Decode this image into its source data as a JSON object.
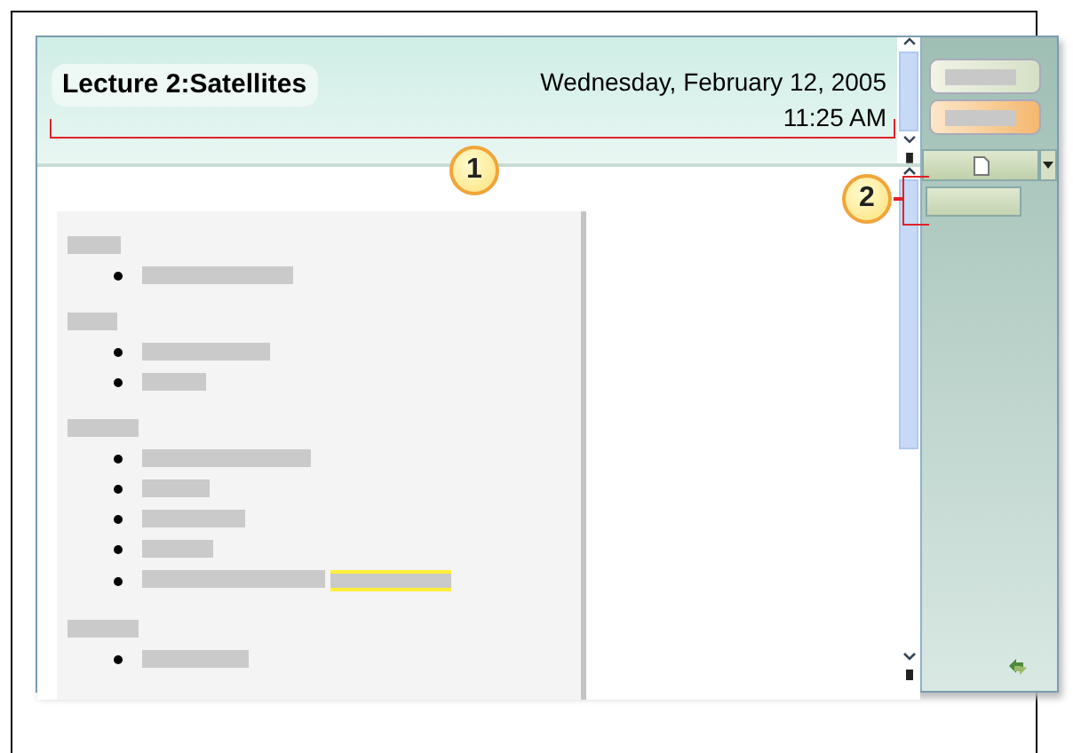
{
  "page": {
    "title": "Lecture 2:Satellites",
    "date": "Wednesday, February 12, 2005",
    "time": "11:25 AM"
  },
  "outline": [
    {
      "items": [
        {
          "highlighted": false
        }
      ]
    },
    {
      "items": [
        {
          "highlighted": false
        },
        {
          "highlighted": false
        }
      ]
    },
    {
      "items": [
        {
          "highlighted": false
        },
        {
          "highlighted": false
        },
        {
          "highlighted": false
        },
        {
          "highlighted": false
        },
        {
          "highlighted": true
        }
      ]
    },
    {
      "items": [
        {
          "highlighted": false
        }
      ]
    }
  ],
  "callouts": [
    {
      "label": "1"
    },
    {
      "label": "2"
    }
  ]
}
